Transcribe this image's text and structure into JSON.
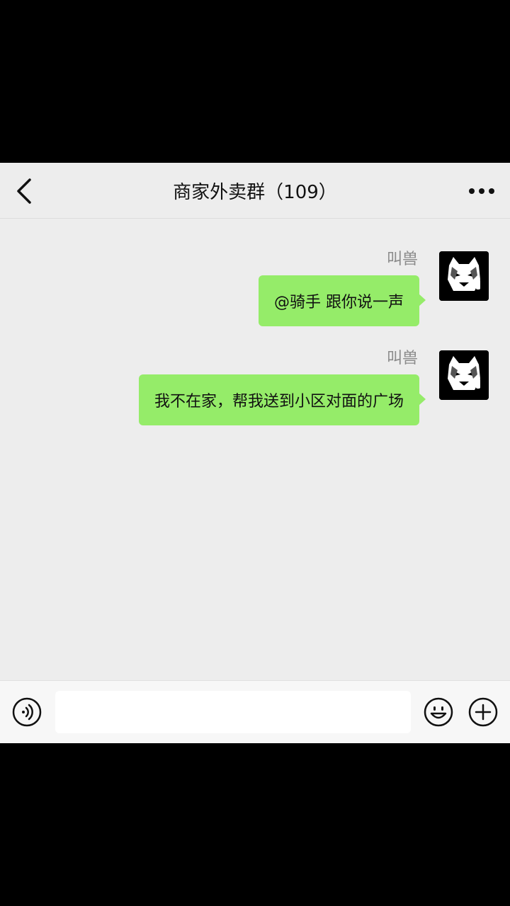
{
  "header": {
    "back_icon": "chevron-left-icon",
    "title": "商家外卖群（109）",
    "more_icon": "more-dots-icon"
  },
  "messages": [
    {
      "sender": "叫兽",
      "text": "@骑手  跟你说一声",
      "avatar": "husky-avatar"
    },
    {
      "sender": "叫兽",
      "text": "我不在家，帮我送到小区对面的广场",
      "avatar": "husky-avatar"
    }
  ],
  "input_bar": {
    "voice_icon": "voice-icon",
    "input_value": "",
    "emoji_icon": "emoji-icon",
    "plus_icon": "plus-icon"
  },
  "colors": {
    "chat_background": "#ededed",
    "bubble_self": "#95ec69",
    "sender_name": "#8a8a8a"
  }
}
